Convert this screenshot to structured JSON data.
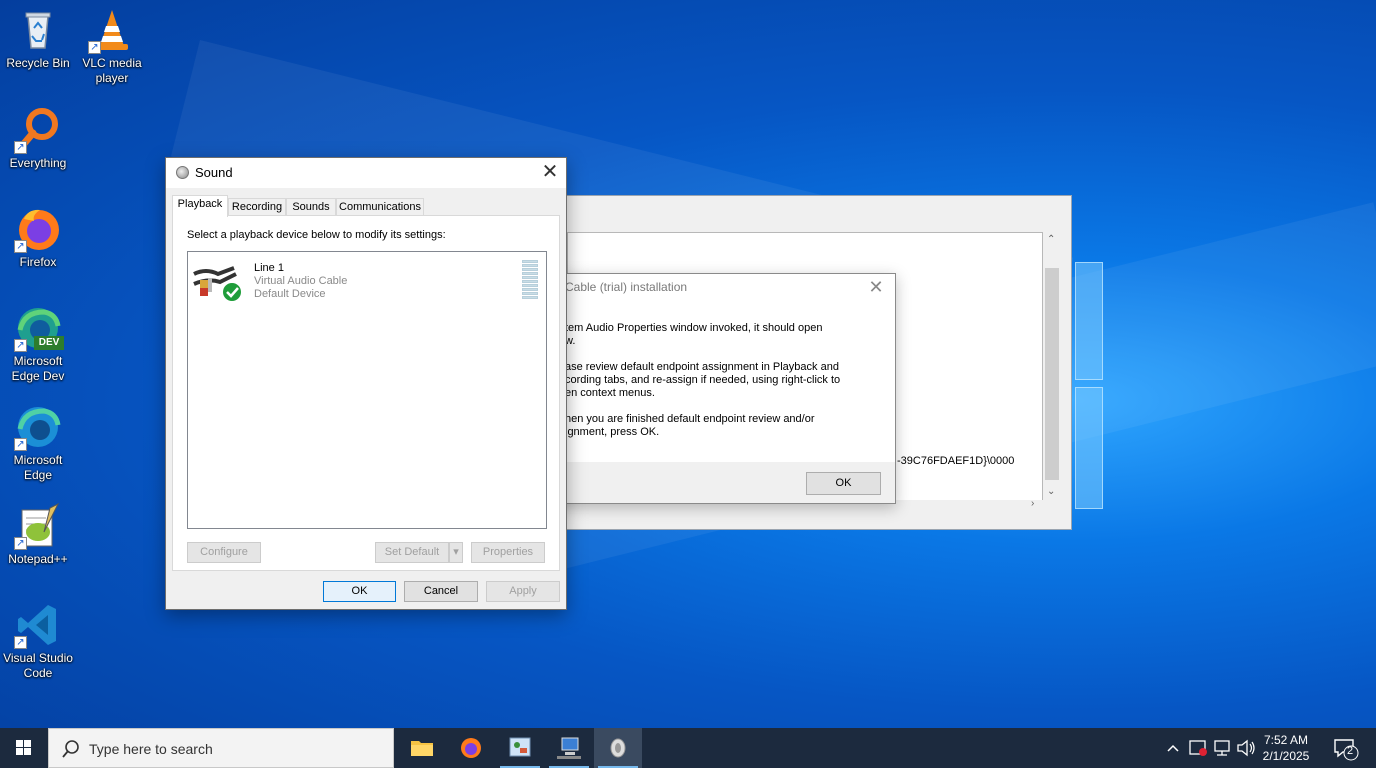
{
  "desktop": {
    "icons": [
      {
        "label": "Recycle Bin",
        "icon": "recycle-bin-icon"
      },
      {
        "label": "VLC media player",
        "icon": "vlc-icon"
      },
      {
        "label": "Everything",
        "icon": "everything-search-icon"
      },
      {
        "label": "Firefox",
        "icon": "firefox-icon"
      },
      {
        "label": "Microsoft Edge Dev",
        "icon": "edge-dev-icon",
        "badge": "DEV"
      },
      {
        "label": "Microsoft Edge",
        "icon": "edge-icon"
      },
      {
        "label": "Notepad++",
        "icon": "notepad-plus-plus-icon"
      },
      {
        "label": "Visual Studio Code",
        "icon": "vscode-icon"
      }
    ]
  },
  "background_window": {
    "guid_fragment": "-39C76FDAEF1D}\\0000"
  },
  "install_dialog": {
    "title": "Cable (trial) installation",
    "paragraphs": [
      "tem Audio Properties window invoked, it should open\nw.",
      "ase review default endpoint assignment in Playback and\ncording tabs, and re-assign if needed, using right-click to\nen context menus.",
      "hen you are finished default endpoint review and/or\nignment, press OK."
    ],
    "ok_label": "OK"
  },
  "sound_dialog": {
    "title": "Sound",
    "tabs": [
      {
        "label": "Playback",
        "active": true
      },
      {
        "label": "Recording",
        "active": false
      },
      {
        "label": "Sounds",
        "active": false
      },
      {
        "label": "Communications",
        "active": false
      }
    ],
    "prompt": "Select a playback device below to modify its settings:",
    "devices": [
      {
        "name": "Line 1",
        "description": "Virtual Audio Cable",
        "status": "Default Device",
        "icon": "audio-cable-icon",
        "status_icon": "green-check-icon"
      }
    ],
    "buttons": {
      "configure": "Configure",
      "set_default": "Set Default",
      "properties": "Properties",
      "ok": "OK",
      "cancel": "Cancel",
      "apply": "Apply"
    }
  },
  "taskbar": {
    "search_placeholder": "Type here to search",
    "apps": [
      {
        "name": "File Explorer",
        "icon": "folder-icon"
      },
      {
        "name": "Firefox",
        "icon": "firefox-icon"
      },
      {
        "name": "Control Panel",
        "icon": "control-panel-icon"
      },
      {
        "name": "Network",
        "icon": "network-computer-icon"
      },
      {
        "name": "Sound",
        "icon": "speaker-icon"
      }
    ],
    "time": "7:52 AM",
    "date": "2/1/2025",
    "notification_count": "2"
  }
}
